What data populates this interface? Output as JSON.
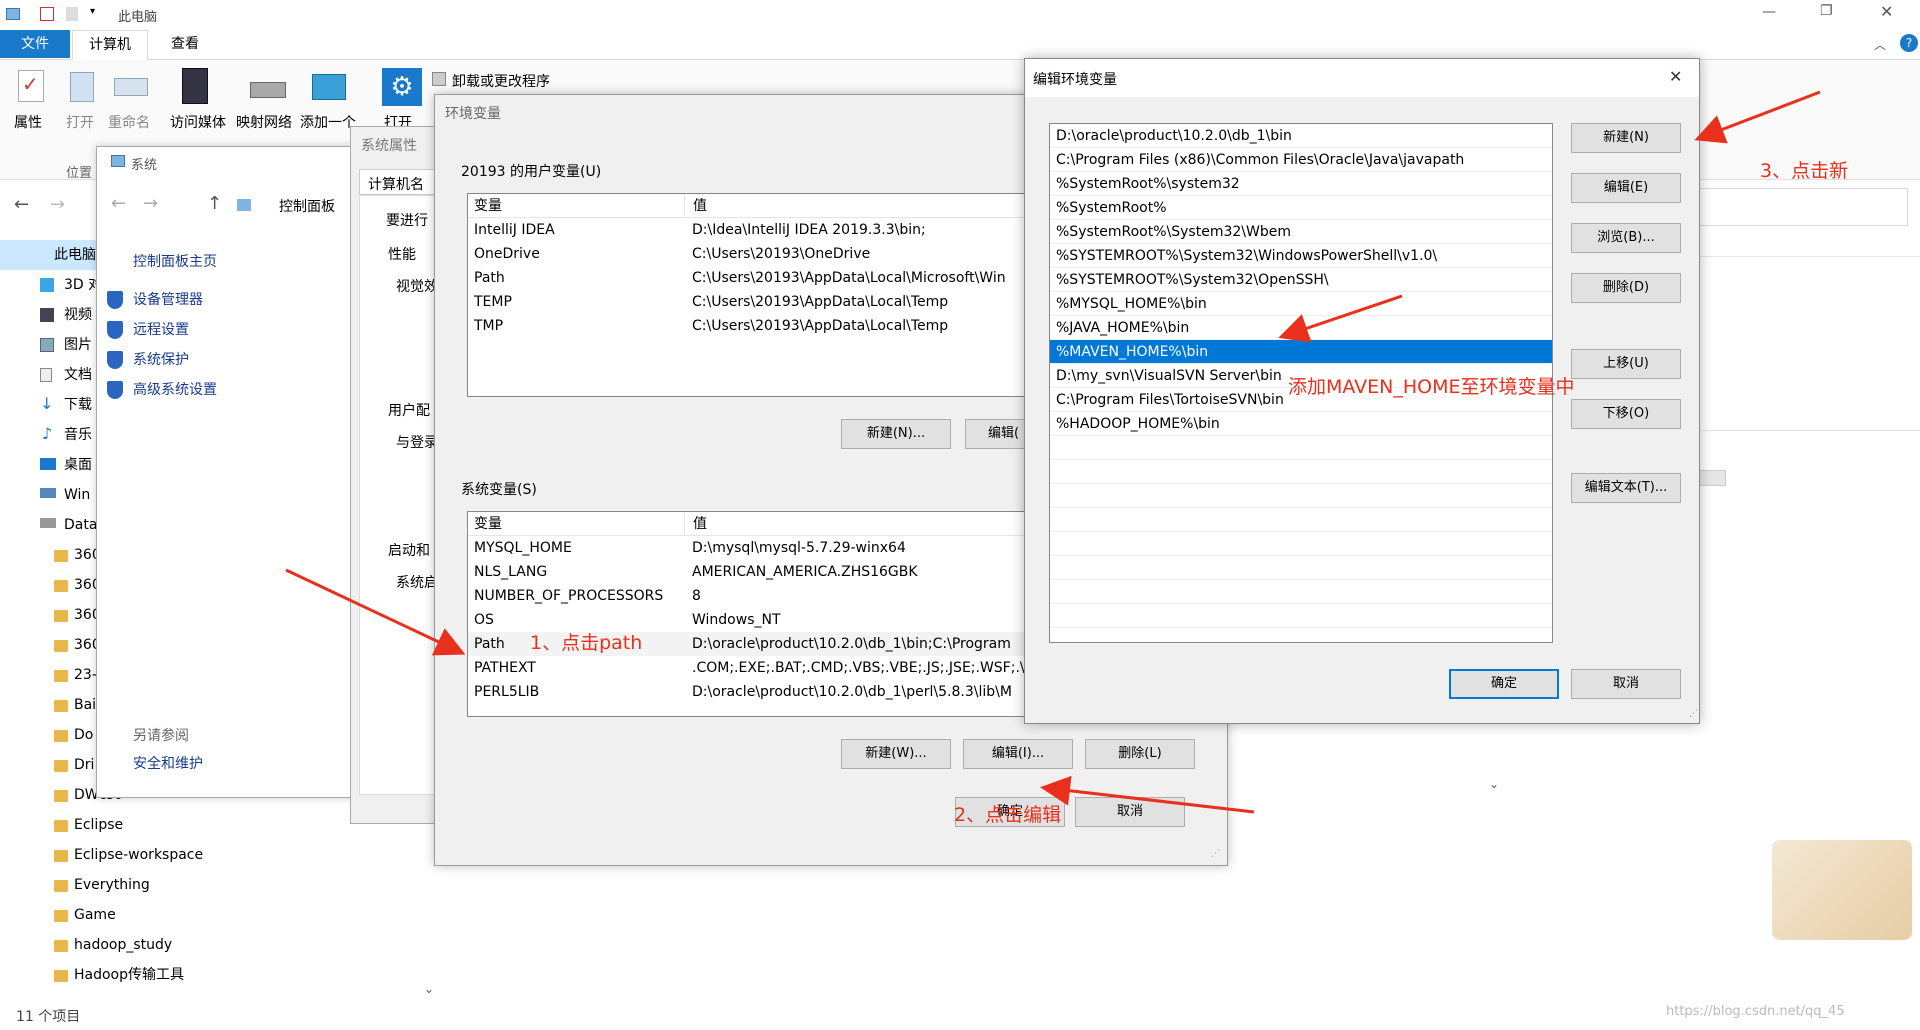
{
  "explorer": {
    "title": "此电脑",
    "ribbon_tabs": [
      "文件",
      "计算机",
      "查看"
    ],
    "ribbon_buttons": [
      "属性",
      "打开",
      "重命名",
      "访问媒体",
      "映射网络",
      "添加一个",
      "打开"
    ],
    "ribbon_uninstall": "卸载或更改程序",
    "group_location": "位置",
    "nav_items": [
      "此电脑",
      "3D 对",
      "视频",
      "图片",
      "文档",
      "下载",
      "音乐",
      "桌面",
      "Win",
      "Data"
    ],
    "folders": [
      "360",
      "360",
      "360",
      "360",
      "23-",
      "Bai",
      "Do",
      "Dri",
      "DWcs6",
      "Eclipse",
      "Eclipse-workspace",
      "Everything",
      "Game",
      "hadoop_study",
      "Hadoop传输工具"
    ],
    "status": "11 个项目"
  },
  "system_window": {
    "title": "系统",
    "breadcrumb": "控制面板",
    "home_link": "控制面板主页",
    "links": [
      "设备管理器",
      "远程设置",
      "系统保护",
      "高级系统设置"
    ],
    "see_also": "另请参阅",
    "security": "安全和维护"
  },
  "sysprops": {
    "title": "系统属性",
    "tab": "计算机名",
    "labels": [
      "要进行",
      "性能",
      "视觉效",
      "用户配",
      "与登录",
      "启动和",
      "系统启"
    ]
  },
  "envvars": {
    "title": "环境变量",
    "user_group": "20193 的用户变量(U)",
    "col_var": "变量",
    "col_val": "值",
    "user_rows": [
      {
        "name": "IntelliJ IDEA",
        "value": "D:\\Idea\\IntelliJ IDEA 2019.3.3\\bin;"
      },
      {
        "name": "OneDrive",
        "value": "C:\\Users\\20193\\OneDrive"
      },
      {
        "name": "Path",
        "value": "C:\\Users\\20193\\AppData\\Local\\Microsoft\\Win"
      },
      {
        "name": "TEMP",
        "value": "C:\\Users\\20193\\AppData\\Local\\Temp"
      },
      {
        "name": "TMP",
        "value": "C:\\Users\\20193\\AppData\\Local\\Temp"
      }
    ],
    "user_new": "新建(N)...",
    "user_edit": "编辑(",
    "sys_group": "系统变量(S)",
    "sys_rows": [
      {
        "name": "MYSQL_HOME",
        "value": "D:\\mysql\\mysql-5.7.29-winx64"
      },
      {
        "name": "NLS_LANG",
        "value": "AMERICAN_AMERICA.ZHS16GBK"
      },
      {
        "name": "NUMBER_OF_PROCESSORS",
        "value": "8"
      },
      {
        "name": "OS",
        "value": "Windows_NT"
      },
      {
        "name": "Path",
        "value": "D:\\oracle\\product\\10.2.0\\db_1\\bin;C:\\Program"
      },
      {
        "name": "PATHEXT",
        "value": ".COM;.EXE;.BAT;.CMD;.VBS;.VBE;.JS;.JSE;.WSF;.\\"
      },
      {
        "name": "PERL5LIB",
        "value": "D:\\oracle\\product\\10.2.0\\db_1\\perl\\5.8.3\\lib\\M"
      }
    ],
    "sys_new": "新建(W)...",
    "sys_edit": "编辑(I)...",
    "sys_delete": "删除(L)",
    "ok": "确定",
    "cancel": "取消"
  },
  "editenv": {
    "title": "编辑环境变量",
    "entries": [
      "D:\\oracle\\product\\10.2.0\\db_1\\bin",
      "C:\\Program Files (x86)\\Common Files\\Oracle\\Java\\javapath",
      "%SystemRoot%\\system32",
      "%SystemRoot%",
      "%SystemRoot%\\System32\\Wbem",
      "%SYSTEMROOT%\\System32\\WindowsPowerShell\\v1.0\\",
      "%SYSTEMROOT%\\System32\\OpenSSH\\",
      "%MYSQL_HOME%\\bin",
      "%JAVA_HOME%\\bin",
      "%MAVEN_HOME%\\bin",
      "D:\\my_svn\\VisualSVN Server\\bin",
      "C:\\Program Files\\TortoiseSVN\\bin",
      "%HADOOP_HOME%\\bin"
    ],
    "selected_index": 9,
    "buttons": [
      "新建(N)",
      "编辑(E)",
      "浏览(B)...",
      "删除(D)",
      "上移(U)",
      "下移(O)",
      "编辑文本(T)..."
    ],
    "ok": "确定",
    "cancel": "取消"
  },
  "annotations": {
    "step1": "1、点击path",
    "step2": "2、点击编辑",
    "step3": "3、点击新",
    "add_note": "添加MAVEN_HOME至环境变量中"
  },
  "watermark": "https://blog.csdn.net/qq_45",
  "colors": {
    "accent": "#0078d7",
    "selection": "#0078d7",
    "annotation": "#e8301c"
  }
}
